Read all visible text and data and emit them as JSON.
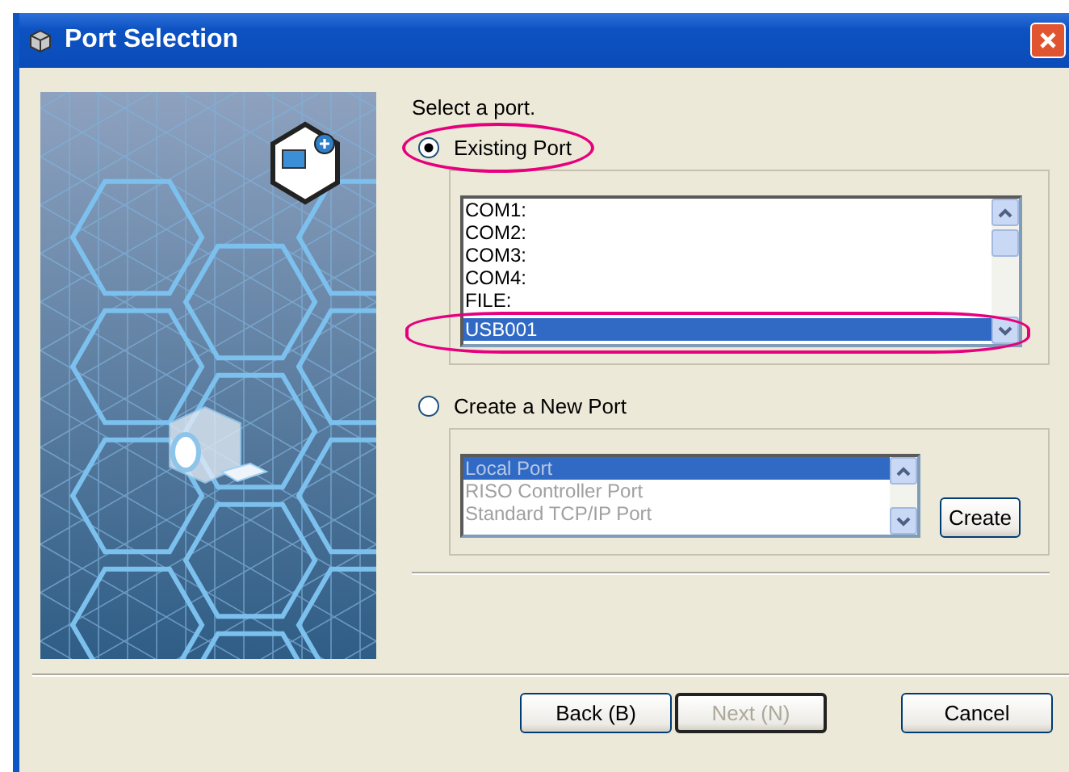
{
  "window": {
    "title": "Port Selection"
  },
  "prompt": "Select a port.",
  "options": [
    {
      "label": "Existing Port",
      "selected": true,
      "highlighted": true,
      "list": {
        "disabled": false,
        "items": [
          {
            "label": "COM1:",
            "selected": false
          },
          {
            "label": "COM2:",
            "selected": false
          },
          {
            "label": "COM3:",
            "selected": false
          },
          {
            "label": "COM4:",
            "selected": false
          },
          {
            "label": "FILE:",
            "selected": false
          },
          {
            "label": "USB001",
            "selected": true,
            "highlighted": true
          }
        ]
      }
    },
    {
      "label": "Create a New Port",
      "selected": false,
      "button": "Create",
      "list": {
        "disabled": true,
        "items": [
          {
            "label": "Local Port",
            "selected": true
          },
          {
            "label": "RISO Controller Port",
            "selected": false
          },
          {
            "label": "Standard TCP/IP Port",
            "selected": false
          }
        ]
      }
    }
  ],
  "buttons": [
    {
      "label": "Back (B)",
      "disabled": false
    },
    {
      "label": "Next (N)",
      "disabled": true
    },
    {
      "label": "Cancel",
      "disabled": false
    }
  ]
}
